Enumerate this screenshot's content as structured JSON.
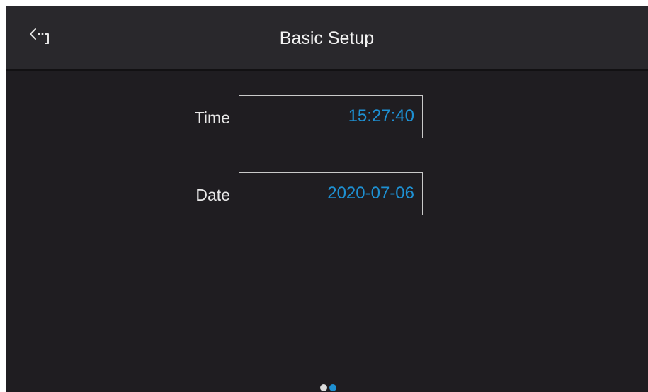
{
  "header": {
    "title": "Basic Setup",
    "back_icon": "back-arrow-icon"
  },
  "fields": {
    "time": {
      "label": "Time",
      "value": "15:27:40"
    },
    "date": {
      "label": "Date",
      "value": "2020-07-06"
    }
  },
  "pager": {
    "total_pages": 2,
    "active_page": 2
  },
  "colors": {
    "background": "#1f1d21",
    "header_background": "#29282c",
    "accent": "#1e90d2",
    "text": "#f2f2f2"
  }
}
